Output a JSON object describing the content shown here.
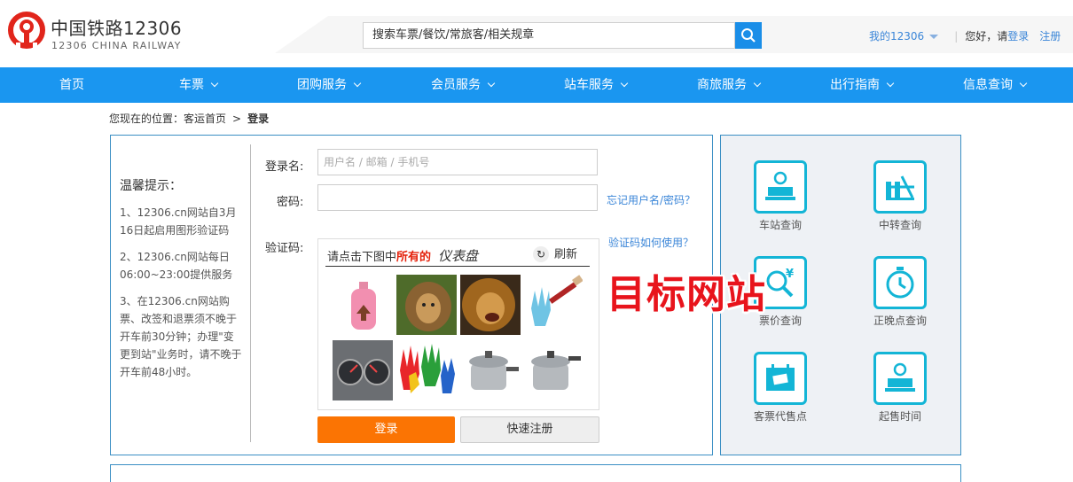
{
  "header": {
    "logo_title": "中国铁路12306",
    "logo_subtitle": "12306 CHINA RAILWAY",
    "search_placeholder": "搜索车票/餐饮/常旅客/相关规章",
    "my12306": "我的12306",
    "greeting": "您好，请",
    "login_link": "登录",
    "register_link": "注册"
  },
  "nav": [
    {
      "label": "首页"
    },
    {
      "label": "车票"
    },
    {
      "label": "团购服务"
    },
    {
      "label": "会员服务"
    },
    {
      "label": "站车服务"
    },
    {
      "label": "商旅服务"
    },
    {
      "label": "出行指南"
    },
    {
      "label": "信息查询"
    }
  ],
  "breadcrumb": {
    "prefix": "您现在的位置：",
    "home": "客运首页",
    "separator": ">",
    "current": "登录"
  },
  "tips": {
    "title": "温馨提示：",
    "items": [
      "1、12306.cn网站自3月16日起启用图形验证码",
      "2、12306.cn网站每日06:00~23:00提供服务",
      "3、在12306.cn网站购票、改签和退票须不晚于开车前30分钟；办理\"变更到站\"业务时，请不晚于开车前48小时。"
    ]
  },
  "form": {
    "username_label": "登录名:",
    "username_placeholder": "用户名 / 邮箱 / 手机号",
    "password_label": "密码:",
    "forgot_link": "忘记用户名/密码？",
    "captcha_label": "验证码:",
    "captcha_help_link": "验证码如何使用？",
    "captcha_prompt": "请点击下图中",
    "captcha_emphasis": "所有的",
    "captcha_word": "仪表盘",
    "refresh_label": "刷新",
    "login_button": "登录",
    "register_button": "快速注册"
  },
  "services": [
    {
      "label": "车站查询",
      "icon": "station-icon"
    },
    {
      "label": "中转查询",
      "icon": "transfer-icon"
    },
    {
      "label": "票价查询",
      "icon": "fare-search-icon"
    },
    {
      "label": "正晚点查询",
      "icon": "stopwatch-icon"
    },
    {
      "label": "客票代售点",
      "icon": "ticket-agency-icon"
    },
    {
      "label": "起售时间",
      "icon": "sale-time-icon"
    }
  ],
  "watermark": "目标网站",
  "colors": {
    "nav_blue": "#1a96f0",
    "login_orange": "#fb7403",
    "icon_cyan": "#13b5d6",
    "logo_red": "#e1251b",
    "border_blue": "#3b8fc4"
  }
}
